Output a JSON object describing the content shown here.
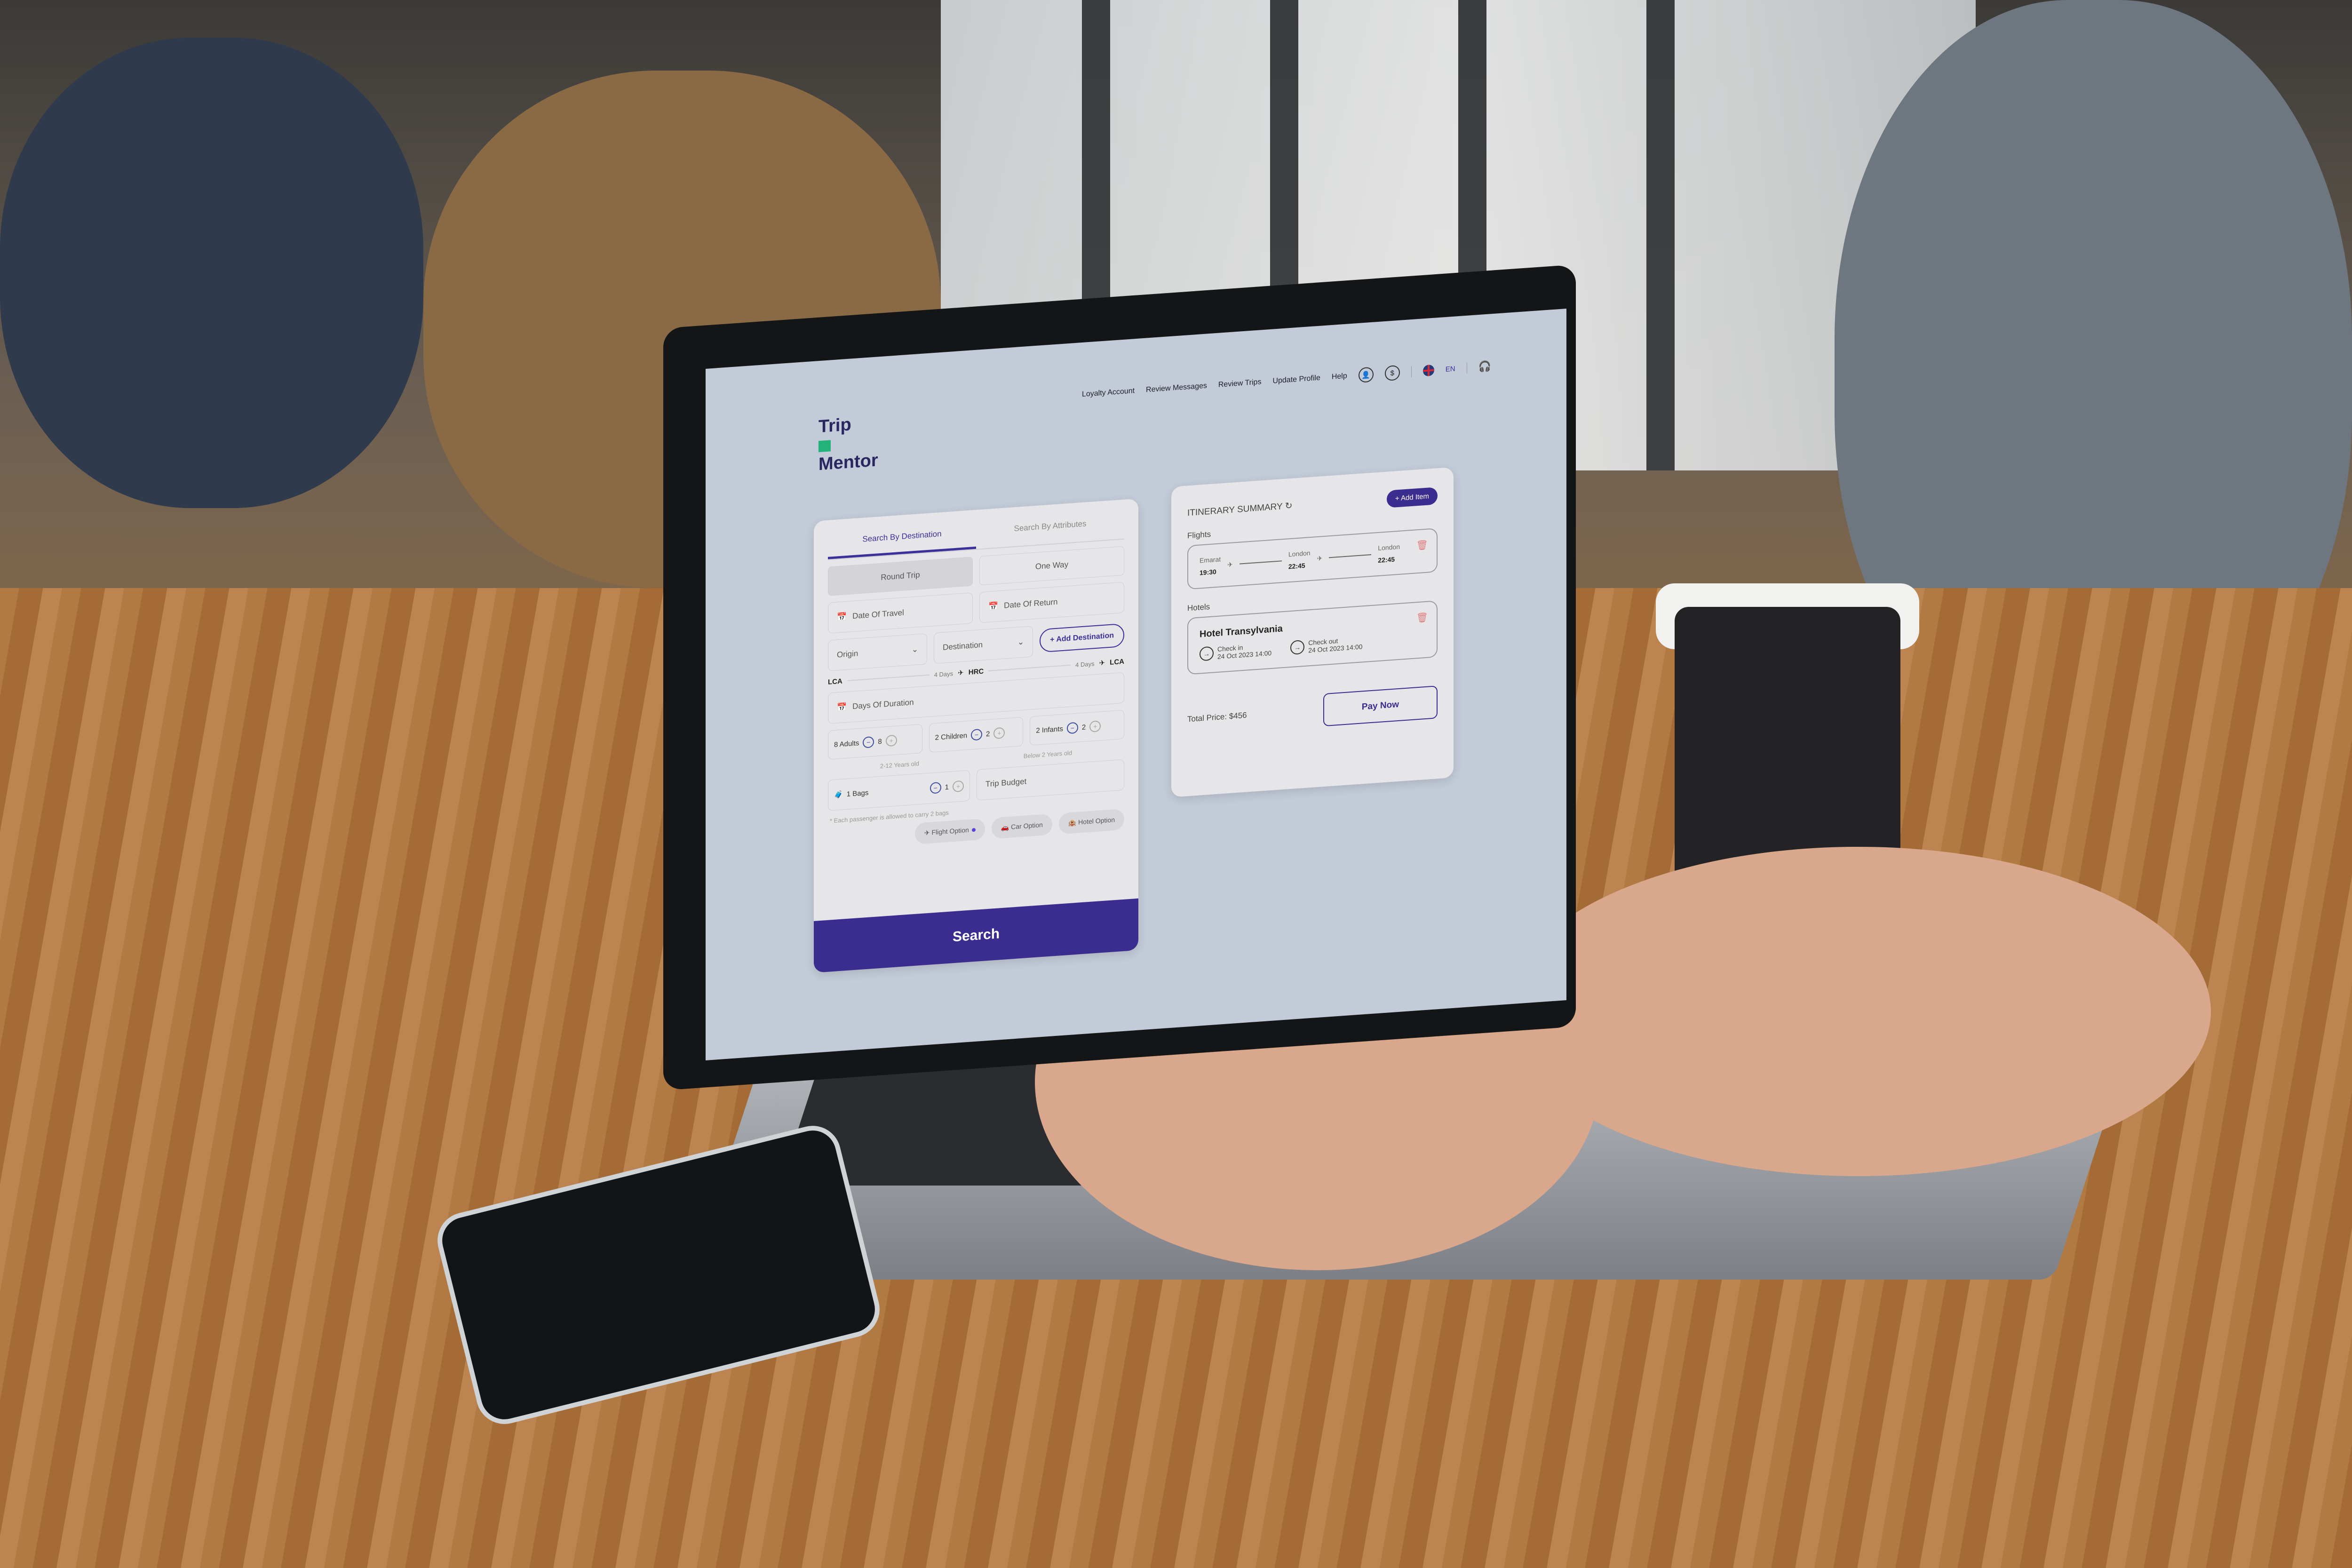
{
  "app": {
    "logo_line1": "Trip",
    "logo_line2": "Mentor"
  },
  "nav": {
    "items": [
      "Loyalty Account",
      "Review Messages",
      "Review Trips",
      "Update Profile",
      "Help"
    ],
    "icons": [
      "user-icon",
      "currency-icon",
      "flag-uk-icon",
      "headset-icon"
    ],
    "language": "EN"
  },
  "search": {
    "tabs": [
      {
        "label": "Search By Destination",
        "active": true
      },
      {
        "label": "Search By Attributes",
        "active": false
      }
    ],
    "trip_types": [
      {
        "label": "Round Trip",
        "active": true
      },
      {
        "label": "One Way",
        "active": false
      }
    ],
    "date_of_travel": "Date Of Travel",
    "date_of_return": "Date Of Return",
    "origin": "Origin",
    "destination": "Destination",
    "add_destination": "+ Add Destination",
    "route": {
      "from": "LCA",
      "leg1_days": "4 Days",
      "via": "HRC",
      "leg2_days": "4 Days",
      "to": "LCA"
    },
    "days_of_duration": "Days Of Duration",
    "passengers": [
      {
        "label": "8 Adults",
        "count": "8",
        "hint": ""
      },
      {
        "label": "2 Children",
        "count": "2",
        "hint": "2-12 Years old"
      },
      {
        "label": "2 Infants",
        "count": "2",
        "hint": "Below 2 Years old"
      }
    ],
    "bags": {
      "label": "1 Bags",
      "count": "1"
    },
    "trip_budget": "Trip Budget",
    "bag_note": "* Each passenger is allowed to carry 2 bags",
    "options": [
      {
        "label": "Flight Option",
        "selected": true
      },
      {
        "label": "Car Option",
        "selected": false
      },
      {
        "label": "Hotel Option",
        "selected": false
      }
    ],
    "search_button": "Search"
  },
  "itinerary": {
    "title": "ITINERARY SUMMARY",
    "add_item": "+ Add Item",
    "flights_label": "Flights",
    "flight": {
      "stops": [
        {
          "city": "Emarat",
          "time": "19:30"
        },
        {
          "city": "London",
          "time": "22:45"
        },
        {
          "city": "London",
          "time": "22:45"
        }
      ]
    },
    "hotels_label": "Hotels",
    "hotel": {
      "name": "Hotel Transylvania",
      "check_in_label": "Check in",
      "check_in": "24 Oct 2023 14:00",
      "check_out_label": "Check out",
      "check_out": "24 Oct 2023 14:00"
    },
    "total_price": "Total Price: $456",
    "pay_now": "Pay Now"
  },
  "colors": {
    "primary": "#3a2d8f",
    "accent_green": "#23b27a",
    "delete": "#e27b7b"
  }
}
